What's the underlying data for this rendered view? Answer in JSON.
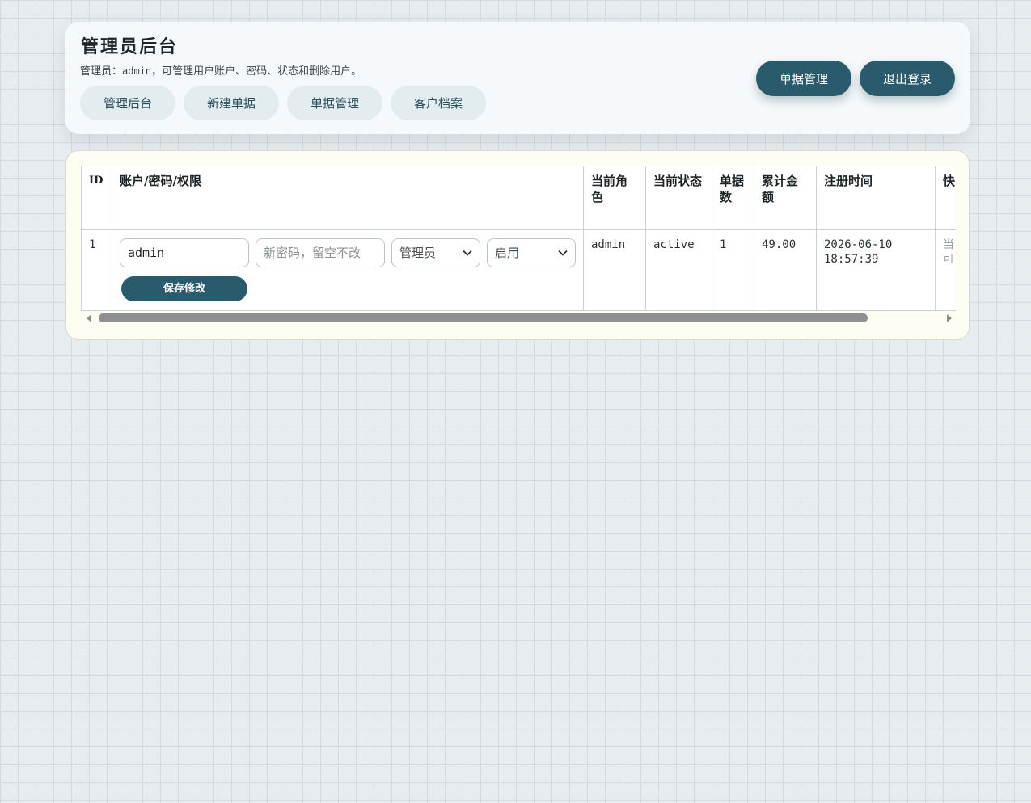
{
  "header": {
    "title": "管理员后台",
    "subtitle_prefix": "管理员：",
    "subtitle_user": "admin",
    "subtitle_suffix": "，可管理用户账户、密码、状态和删除用户。",
    "nav": [
      {
        "label": "管理后台"
      },
      {
        "label": "新建单据"
      },
      {
        "label": "单据管理"
      },
      {
        "label": "客户档案"
      }
    ],
    "actions": {
      "bills_label": "单据管理",
      "logout_label": "退出登录"
    },
    "accent_color": "#2a5b6c"
  },
  "table": {
    "columns": [
      "ID",
      "账户/密码/权限",
      "当前角色",
      "当前状态",
      "单据数",
      "累计金额",
      "注册时间",
      "快"
    ],
    "rows": [
      {
        "id": "1",
        "username_value": "admin",
        "password_placeholder": "新密码，留空不改",
        "role_select": "管理员",
        "status_select": "启用",
        "save_label": "保存修改",
        "current_role": "admin",
        "current_status": "active",
        "bill_count": "1",
        "total_amount": "49.00",
        "registered_date": "2026-06-10",
        "registered_time": "18:57:39",
        "quick_line1": "当",
        "quick_line2": "可"
      }
    ]
  }
}
